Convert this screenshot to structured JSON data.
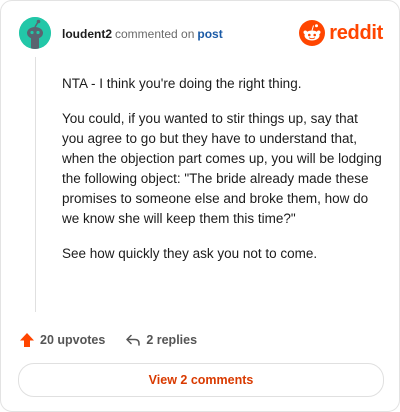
{
  "header": {
    "username": "loudent2",
    "action_text": "commented on",
    "post_link": "post",
    "logo_text": "reddit",
    "avatar_icon": "snoo-avatar-icon",
    "logo_icon": "reddit-alien-icon"
  },
  "comment": {
    "paragraphs": [
      "NTA - I think you're doing the right thing.",
      "You could, if you wanted to stir things up, say that you agree to go but they have to understand that, when the objection part comes up, you will be lodging the following object: \"The bride already made these promises to someone else and broke them, how do we know she will keep them this time?\"",
      "See how quickly they ask you not to come."
    ]
  },
  "actions": {
    "upvotes_label": "20 upvotes",
    "replies_label": "2 replies",
    "upvote_icon": "upvote-arrow-icon",
    "reply_icon": "reply-arrow-icon"
  },
  "footer": {
    "view_comments_label": "View 2 comments"
  },
  "colors": {
    "accent": "#ff4500",
    "link": "#1a5aa6",
    "avatar": "#22c7a8",
    "button_text": "#d93a00"
  }
}
